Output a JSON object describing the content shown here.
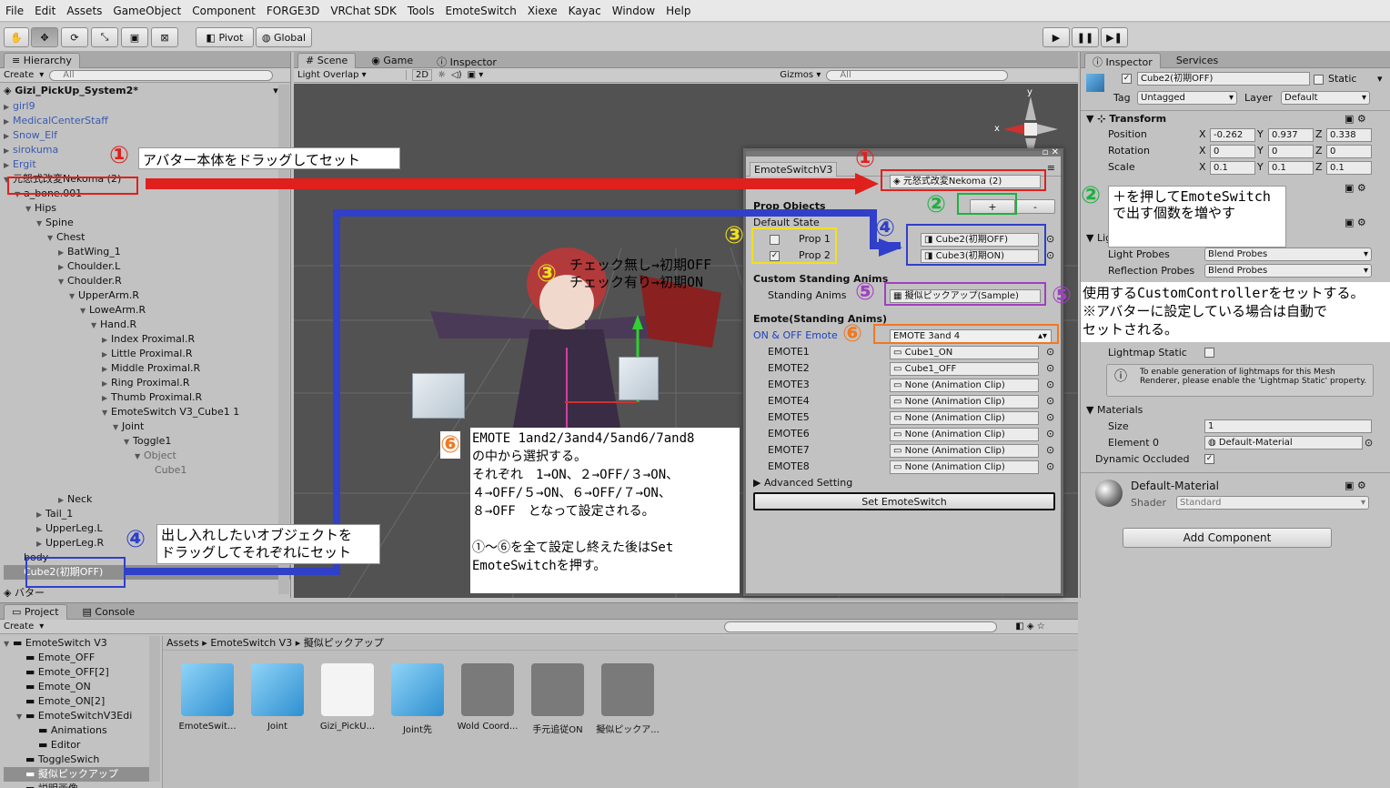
{
  "menu": [
    "File",
    "Edit",
    "Assets",
    "GameObject",
    "Component",
    "FORGE3D",
    "VRChat SDK",
    "Tools",
    "EmoteSwitch",
    "Xiexe",
    "Kayac",
    "Window",
    "Help"
  ],
  "toolbar": {
    "pivot": "Pivot",
    "global": "Global"
  },
  "hierarchy": {
    "tab": "Hierarchy",
    "create": "Create",
    "search_placeholder": "All",
    "scene_name": "Gizi_PickUp_System2*",
    "rows": [
      {
        "label": "girl9",
        "indent": 0,
        "blue": true,
        "tri": "▶"
      },
      {
        "label": "MedicalCenterStaff",
        "indent": 0,
        "blue": true,
        "tri": "▶"
      },
      {
        "label": "Snow_Elf",
        "indent": 0,
        "blue": true,
        "tri": "▶"
      },
      {
        "label": "sirokuma",
        "indent": 0,
        "blue": true,
        "tri": "▶"
      },
      {
        "label": "Ergit",
        "indent": 0,
        "blue": true,
        "tri": "▶"
      },
      {
        "label": "元怒式改変Nekoma (2)",
        "indent": 0,
        "blue": false,
        "tri": "▼"
      },
      {
        "label": "a_bone.001",
        "indent": 1,
        "blue": false,
        "tri": "▼"
      },
      {
        "label": "Hips",
        "indent": 2,
        "blue": false,
        "tri": "▼"
      },
      {
        "label": "Spine",
        "indent": 3,
        "blue": false,
        "tri": "▼"
      },
      {
        "label": "Chest",
        "indent": 4,
        "blue": false,
        "tri": "▼"
      },
      {
        "label": "BatWing_1",
        "indent": 5,
        "blue": false,
        "tri": "▶"
      },
      {
        "label": "Choulder.L",
        "indent": 5,
        "blue": false,
        "tri": "▶"
      },
      {
        "label": "Choulder.R",
        "indent": 5,
        "blue": false,
        "tri": "▼"
      },
      {
        "label": "UpperArm.R",
        "indent": 6,
        "blue": false,
        "tri": "▼"
      },
      {
        "label": "LoweArm.R",
        "indent": 7,
        "blue": false,
        "tri": "▼"
      },
      {
        "label": "Hand.R",
        "indent": 8,
        "blue": false,
        "tri": "▼"
      },
      {
        "label": "Index Proximal.R",
        "indent": 9,
        "blue": false,
        "tri": "▶"
      },
      {
        "label": "Little Proximal.R",
        "indent": 9,
        "blue": false,
        "tri": "▶"
      },
      {
        "label": "Middle Proximal.R",
        "indent": 9,
        "blue": false,
        "tri": "▶"
      },
      {
        "label": "Ring Proximal.R",
        "indent": 9,
        "blue": false,
        "tri": "▶"
      },
      {
        "label": "Thumb Proximal.R",
        "indent": 9,
        "blue": false,
        "tri": "▶"
      },
      {
        "label": "EmoteSwitch V3_Cube1 1",
        "indent": 9,
        "blue": false,
        "tri": "▼"
      },
      {
        "label": "Joint",
        "indent": 10,
        "blue": false,
        "tri": "▼"
      },
      {
        "label": "Toggle1",
        "indent": 11,
        "blue": false,
        "tri": "▼"
      },
      {
        "label": "Object",
        "indent": 12,
        "blue": false,
        "tri": "▼",
        "grey": true
      },
      {
        "label": "Cube1",
        "indent": 13,
        "blue": false,
        "tri": "",
        "grey": true
      },
      {
        "label": "",
        "indent": 0,
        "blue": false,
        "tri": ""
      },
      {
        "label": "Neck",
        "indent": 5,
        "blue": false,
        "tri": "▶"
      },
      {
        "label": "Tail_1",
        "indent": 3,
        "blue": false,
        "tri": "▶"
      },
      {
        "label": "UpperLeg.L",
        "indent": 3,
        "blue": false,
        "tri": "▶"
      },
      {
        "label": "UpperLeg.R",
        "indent": 3,
        "blue": false,
        "tri": "▶"
      },
      {
        "label": "body",
        "indent": 1,
        "blue": false,
        "tri": ""
      },
      {
        "label": "Cube2(初期OFF)",
        "indent": 1,
        "blue": false,
        "tri": "",
        "sel": true
      },
      {
        "label": "Cube3(初期ON)",
        "indent": 1,
        "blue": false,
        "tri": ""
      }
    ],
    "bottom_label": "バター"
  },
  "scene": {
    "tab_scene": "Scene",
    "tab_game": "Game",
    "tab_inspector": "Inspector",
    "shading": "Light Overlap",
    "mode2d": "2D",
    "gizmos": "Gizmos",
    "search_placeholder": "All",
    "axis_y": "y",
    "axis_x": "x"
  },
  "emote": {
    "tab": "EmoteSwitchV3",
    "avatar": "元怒式改変Nekoma (2)",
    "plus": "+",
    "minus": "-",
    "prop_objects": "Prop Objects",
    "default_state": "Default State",
    "props": [
      {
        "label": "Prop 1",
        "checked": false,
        "obj": "Cube2(初期OFF)"
      },
      {
        "label": "Prop 2",
        "checked": true,
        "obj": "Cube3(初期ON)"
      }
    ],
    "custom_anims": "Custom Standing Anims",
    "standing_anims": "Standing Anims",
    "standing_value": "擬似ピックアップ(Sample)",
    "emote_header": "Emote(Standing Anims)",
    "onoff_label": "ON & OFF Emote",
    "onoff_value": "EMOTE 3and 4",
    "emotes": [
      {
        "label": "EMOTE1",
        "value": "Cube1_ON"
      },
      {
        "label": "EMOTE2",
        "value": "Cube1_OFF"
      },
      {
        "label": "EMOTE3",
        "value": "None (Animation Clip)"
      },
      {
        "label": "EMOTE4",
        "value": "None (Animation Clip)"
      },
      {
        "label": "EMOTE5",
        "value": "None (Animation Clip)"
      },
      {
        "label": "EMOTE6",
        "value": "None (Animation Clip)"
      },
      {
        "label": "EMOTE7",
        "value": "None (Animation Clip)"
      },
      {
        "label": "EMOTE8",
        "value": "None (Animation Clip)"
      }
    ],
    "advanced": "Advanced Setting",
    "set_button": "Set EmoteSwitch"
  },
  "inspector": {
    "tab": "Inspector",
    "tab2": "Services",
    "object_name": "Cube2(初期OFF)",
    "static_label": "Static",
    "tag_label": "Tag",
    "tag_value": "Untagged",
    "layer_label": "Layer",
    "layer_value": "Default",
    "transform": "Transform",
    "position": "Position",
    "rotation": "Rotation",
    "scale": "Scale",
    "pos": [
      "-0.262",
      "0.937",
      "0.338"
    ],
    "rot": [
      "0",
      "0",
      "0"
    ],
    "scl": [
      "0.1",
      "0.1",
      "0.1"
    ],
    "xyz": [
      "X",
      "Y",
      "Z"
    ],
    "light_probes_label": "Light Probes",
    "light_probes_value": "Blend Probes",
    "refl_probes_label": "Reflection Probes",
    "refl_probes_value": "Blend Probes",
    "ligh_label": "Ligh",
    "lightmap_static": "Lightmap Static",
    "lightmap_info": "To enable generation of lightmaps for this Mesh Renderer, please enable the 'Lightmap Static' property.",
    "materials": "Materials",
    "size_label": "Size",
    "size_value": "1",
    "element0_label": "Element 0",
    "element0_value": "Default-Material",
    "dynamic_occluded": "Dynamic Occluded",
    "material_name": "Default-Material",
    "shader_label": "Shader",
    "shader_value": "Standard",
    "add_component": "Add Component"
  },
  "project": {
    "tab": "Project",
    "tab2": "Console",
    "create": "Create",
    "folders": [
      {
        "label": "EmoteSwitch V3",
        "indent": 0,
        "tri": "▼"
      },
      {
        "label": "Emote_OFF",
        "indent": 1,
        "tri": ""
      },
      {
        "label": "Emote_OFF[2]",
        "indent": 1,
        "tri": ""
      },
      {
        "label": "Emote_ON",
        "indent": 1,
        "tri": ""
      },
      {
        "label": "Emote_ON[2]",
        "indent": 1,
        "tri": ""
      },
      {
        "label": "EmoteSwitchV3Edi",
        "indent": 1,
        "tri": "▼"
      },
      {
        "label": "Animations",
        "indent": 2,
        "tri": ""
      },
      {
        "label": "Editor",
        "indent": 2,
        "tri": ""
      },
      {
        "label": "ToggleSwich",
        "indent": 1,
        "tri": ""
      },
      {
        "label": "擬似ピックアップ",
        "indent": 1,
        "tri": "",
        "sel": true
      },
      {
        "label": "説明画像",
        "indent": 1,
        "tri": ""
      }
    ],
    "breadcrumb": [
      "Assets",
      "EmoteSwitch V3",
      "擬似ピックアップ"
    ],
    "assets": [
      "EmoteSwit...",
      "Joint",
      "Gizi_PickU...",
      "Joint先",
      "Wold Coord...",
      "手元追従ON",
      "擬似ピックア..."
    ]
  },
  "callouts": {
    "c1_num": "①",
    "c1_text": "アバター本体をドラッグしてセット",
    "c2_num": "②",
    "c2_text": "＋を押してEmoteSwitch\nで出す個数を増やす",
    "c3_num": "③",
    "c3_text": "チェック無し→初期OFF\nチェック有り→初期ON",
    "c4_num": "④",
    "c4_text": "出し入れしたいオブジェクトを\nドラッグしてそれぞれにセット",
    "c5_num": "⑤",
    "c5_text": "使用するCustomControllerをセットする。\n※アバターに設定している場合は自動で\nセットされる。",
    "c6_num": "⑥",
    "c6_text": "EMOTE 1and2/3and4/5and6/7and8\nの中から選択する。\nそれぞれ　1→ON、２→OFF/３→ON、\n４→OFF/５→ON、６→OFF/７→ON、\n８→OFF　となって設定される。\n\n①～⑥を全て設定し終えた後はSet\nEmoteSwitchを押す。",
    "n1": "①",
    "n2": "②",
    "n3": "③",
    "n4": "④",
    "n5": "⑤",
    "n6": "⑥"
  },
  "colors": {
    "red": "#e0201c",
    "blue": "#3040c8",
    "green": "#20b040",
    "yellow": "#f0e020",
    "purple": "#a040c0",
    "orange": "#f07820"
  }
}
